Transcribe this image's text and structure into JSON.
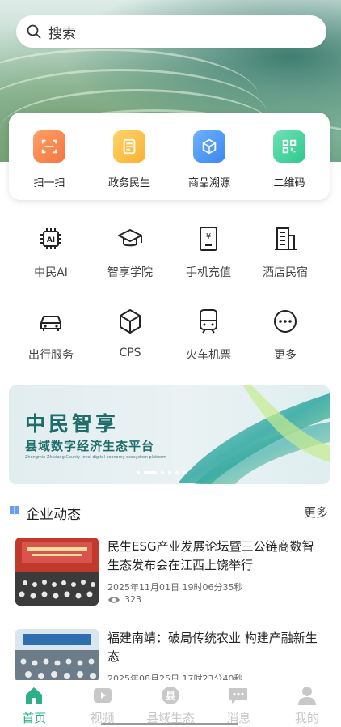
{
  "search": {
    "placeholder": "搜索"
  },
  "quick_actions": [
    {
      "label": "扫一扫",
      "icon": "scan-icon",
      "color": "#f2763f"
    },
    {
      "label": "政务民生",
      "icon": "document-icon",
      "color": "#f7b230"
    },
    {
      "label": "商品溯源",
      "icon": "trace-cube-icon",
      "color": "#3a88f0"
    },
    {
      "label": "二维码",
      "icon": "qrcode-icon",
      "color": "#2ec98e"
    }
  ],
  "services": [
    {
      "label": "中民AI",
      "icon": "ai-chip-icon"
    },
    {
      "label": "智享学院",
      "icon": "graduation-cap-icon"
    },
    {
      "label": "手机充值",
      "icon": "phone-recharge-icon"
    },
    {
      "label": "酒店民宿",
      "icon": "hotel-building-icon"
    },
    {
      "label": "出行服务",
      "icon": "car-icon"
    },
    {
      "label": "CPS",
      "icon": "cps-cube-icon"
    },
    {
      "label": "火车机票",
      "icon": "train-icon"
    },
    {
      "label": "更多",
      "icon": "more-dots-icon"
    }
  ],
  "banner": {
    "title": "中民智享",
    "subtitle": "县域数字经济生态平台",
    "english": "Zhongmin Zhixiang County-level digital economy ecosystem platform",
    "slide_count": 6,
    "active_slide": 2
  },
  "news_section": {
    "title": "企业动态",
    "more_label": "更多"
  },
  "news": [
    {
      "title": "民生ESG产业发展论坛暨三公链商数智生态发布会在江西上饶举行",
      "date": "2025年11月01日 19时06分35秒",
      "views": "323"
    },
    {
      "title": "福建南靖：破局传统农业 构建产融新生态",
      "date": "2025年08月25日 17时23分40秒"
    }
  ],
  "tabbar": [
    {
      "label": "首页",
      "icon": "home-icon",
      "active": true
    },
    {
      "label": "视频",
      "icon": "video-icon",
      "active": false
    },
    {
      "label": "县域生态",
      "icon": "county-icon",
      "active": false
    },
    {
      "label": "消息",
      "icon": "message-icon",
      "active": false
    },
    {
      "label": "我的",
      "icon": "profile-icon",
      "active": false
    }
  ],
  "colors": {
    "accent": "#2bb08a",
    "banner_text": "#1f6d6a",
    "tab_inactive": "#c8c8c8"
  }
}
